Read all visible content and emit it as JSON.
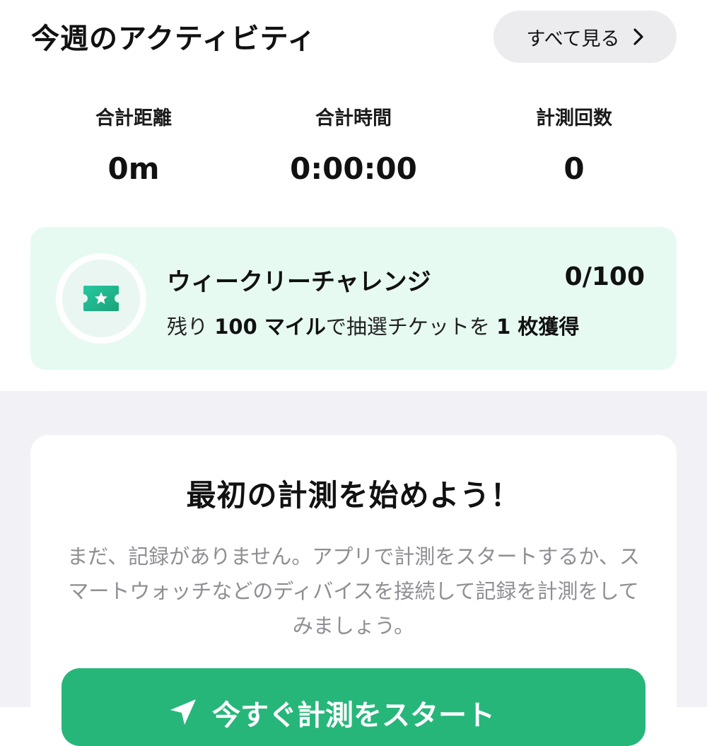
{
  "activity": {
    "title": "今週のアクティビティ",
    "see_all_label": "すべて見る",
    "stats": [
      {
        "label": "合計距離",
        "value": "0m"
      },
      {
        "label": "合計時間",
        "value": "0:00:00"
      },
      {
        "label": "計測回数",
        "value": "0"
      }
    ]
  },
  "challenge": {
    "title": "ウィークリーチャレンジ",
    "progress": "0/100",
    "desc_prefix": "残り ",
    "desc_miles": "100 マイル",
    "desc_middle": "で抽選チケットを ",
    "desc_reward": "1 枚獲得",
    "icon": "ticket-star-icon"
  },
  "empty_state": {
    "title": "最初の計測を始めよう！",
    "description": "まだ、記録がありません。アプリで計測をスタートするか、スマートウォッチなどのディバイスを接続して記録を計測をしてみましょう。",
    "button_label": "今すぐ計測をスタート",
    "button_icon": "navigation-arrow-icon"
  },
  "colors": {
    "accent_green": "#27b67a",
    "challenge_bg": "#e6faf1",
    "muted_text": "#8e8e93",
    "page_bg": "#f2f2f6"
  }
}
